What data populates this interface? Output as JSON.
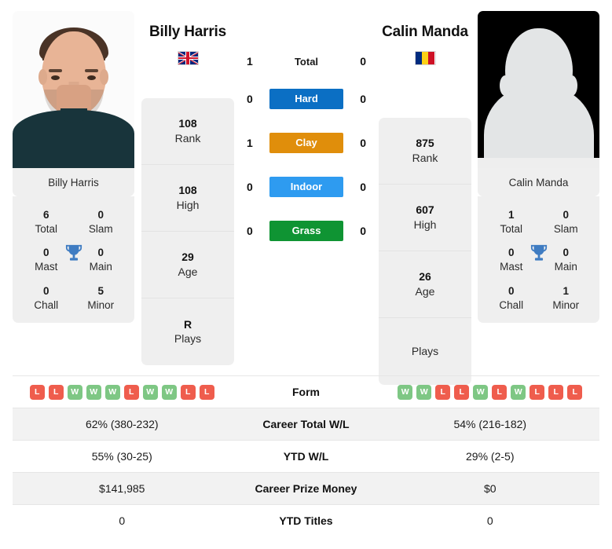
{
  "players": {
    "left": {
      "name": "Billy Harris",
      "flag": "gb-flag-icon",
      "country": "Great Britain",
      "photo_name": "Billy Harris",
      "stats": [
        {
          "value": "108",
          "label": "Rank"
        },
        {
          "value": "108",
          "label": "High"
        },
        {
          "value": "29",
          "label": "Age"
        },
        {
          "value": "R",
          "label": "Plays"
        }
      ],
      "titles": [
        {
          "value": "6",
          "label": "Total"
        },
        {
          "value": "0",
          "label": "Slam"
        },
        {
          "value": "0",
          "label": "Mast"
        },
        {
          "value": "0",
          "label": "Main"
        },
        {
          "value": "0",
          "label": "Chall"
        },
        {
          "value": "5",
          "label": "Minor"
        }
      ],
      "form": [
        "L",
        "L",
        "W",
        "W",
        "W",
        "L",
        "W",
        "W",
        "L",
        "L"
      ],
      "career_total_wl": "62% (380-232)",
      "ytd_wl": "55% (30-25)",
      "career_prize_money": "$141,985",
      "ytd_titles": "0"
    },
    "right": {
      "name": "Calin Manda",
      "flag": "ro-flag-icon",
      "country": "Romania",
      "photo_name": "Calin Manda",
      "stats": [
        {
          "value": "875",
          "label": "Rank"
        },
        {
          "value": "607",
          "label": "High"
        },
        {
          "value": "26",
          "label": "Age"
        },
        {
          "value": "",
          "label": "Plays"
        }
      ],
      "titles": [
        {
          "value": "1",
          "label": "Total"
        },
        {
          "value": "0",
          "label": "Slam"
        },
        {
          "value": "0",
          "label": "Mast"
        },
        {
          "value": "0",
          "label": "Main"
        },
        {
          "value": "0",
          "label": "Chall"
        },
        {
          "value": "1",
          "label": "Minor"
        }
      ],
      "form": [
        "W",
        "W",
        "L",
        "L",
        "W",
        "L",
        "W",
        "L",
        "L",
        "L"
      ],
      "career_total_wl": "54% (216-182)",
      "ytd_wl": "29% (2-5)",
      "career_prize_money": "$0",
      "ytd_titles": "0"
    }
  },
  "head_to_head": {
    "total": {
      "label": "Total",
      "left": "1",
      "right": "0"
    },
    "surfaces": [
      {
        "label": "Hard",
        "left": "0",
        "right": "0",
        "color": "#0b6fc4"
      },
      {
        "label": "Clay",
        "left": "1",
        "right": "0",
        "color": "#e08e0b"
      },
      {
        "label": "Indoor",
        "left": "0",
        "right": "0",
        "color": "#2e9bf0"
      },
      {
        "label": "Grass",
        "left": "0",
        "right": "0",
        "color": "#0f9433"
      }
    ]
  },
  "table": {
    "rows": [
      {
        "label": "Form"
      },
      {
        "label": "Career Total W/L",
        "left": "62% (380-232)",
        "right": "54% (216-182)"
      },
      {
        "label": "YTD W/L",
        "left": "55% (30-25)",
        "right": "29% (2-5)"
      },
      {
        "label": "Career Prize Money",
        "left": "$141,985",
        "right": "$0"
      },
      {
        "label": "YTD Titles",
        "left": "0",
        "right": "0"
      }
    ]
  },
  "colors": {
    "win": "#7ec784",
    "loss": "#ef5d4d",
    "card_bg": "#efefef",
    "row_shade": "#f2f2f2",
    "trophy": "#3f7cc2"
  }
}
